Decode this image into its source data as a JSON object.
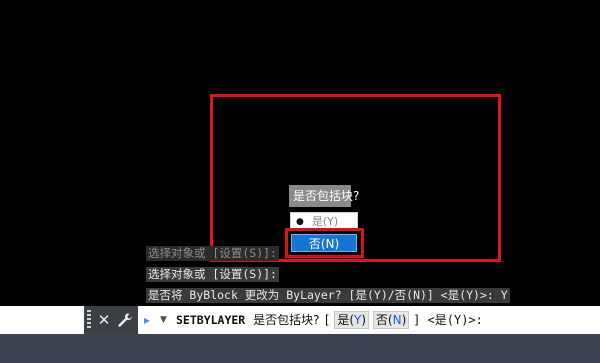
{
  "drawing": {
    "rectangle_color": "#e0141e",
    "highlight_color": "#d8121c"
  },
  "dynamic_input": {
    "prompt": "是否包括块?",
    "option_yes": "是(Y)",
    "option_no": "否(N)",
    "selected_color": "#1476d2",
    "bullet_icon": "bullet-dot"
  },
  "history": {
    "line1": "选择对象或 [设置(S)]:",
    "line2": "选择对象或 [设置(S)]:",
    "line3": "是否将 ByBlock 更改为 ByLayer? [是(Y)/否(N)] <是(Y)>: Y"
  },
  "command_line": {
    "close_icon": "close-icon",
    "wrench_icon": "wrench-icon",
    "recent_icon": "command-prompt-icon",
    "command_name": "SETBYLAYER",
    "prompt": "是否包括块?",
    "bracket_open": "[",
    "option_yes_key": "Y",
    "option_yes_prefix": "是(",
    "option_yes_suffix": ")",
    "option_no_key": "N",
    "option_no_prefix": "否(",
    "option_no_suffix": ")",
    "tail": "] <是(Y)>:"
  }
}
